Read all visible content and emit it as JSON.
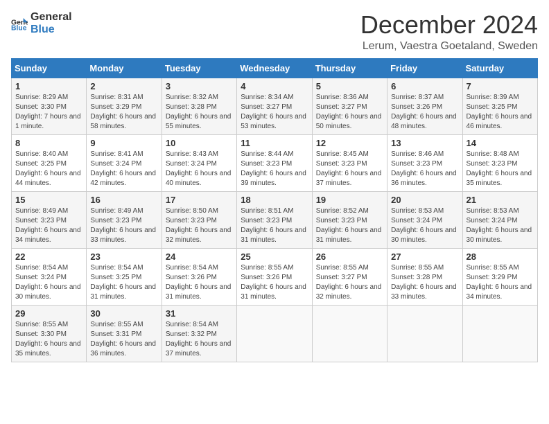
{
  "header": {
    "logo_general": "General",
    "logo_blue": "Blue",
    "title": "December 2024",
    "subtitle": "Lerum, Vaestra Goetaland, Sweden"
  },
  "weekdays": [
    "Sunday",
    "Monday",
    "Tuesday",
    "Wednesday",
    "Thursday",
    "Friday",
    "Saturday"
  ],
  "weeks": [
    [
      {
        "day": "1",
        "sunrise": "Sunrise: 8:29 AM",
        "sunset": "Sunset: 3:30 PM",
        "daylight": "Daylight: 7 hours and 1 minute."
      },
      {
        "day": "2",
        "sunrise": "Sunrise: 8:31 AM",
        "sunset": "Sunset: 3:29 PM",
        "daylight": "Daylight: 6 hours and 58 minutes."
      },
      {
        "day": "3",
        "sunrise": "Sunrise: 8:32 AM",
        "sunset": "Sunset: 3:28 PM",
        "daylight": "Daylight: 6 hours and 55 minutes."
      },
      {
        "day": "4",
        "sunrise": "Sunrise: 8:34 AM",
        "sunset": "Sunset: 3:27 PM",
        "daylight": "Daylight: 6 hours and 53 minutes."
      },
      {
        "day": "5",
        "sunrise": "Sunrise: 8:36 AM",
        "sunset": "Sunset: 3:27 PM",
        "daylight": "Daylight: 6 hours and 50 minutes."
      },
      {
        "day": "6",
        "sunrise": "Sunrise: 8:37 AM",
        "sunset": "Sunset: 3:26 PM",
        "daylight": "Daylight: 6 hours and 48 minutes."
      },
      {
        "day": "7",
        "sunrise": "Sunrise: 8:39 AM",
        "sunset": "Sunset: 3:25 PM",
        "daylight": "Daylight: 6 hours and 46 minutes."
      }
    ],
    [
      {
        "day": "8",
        "sunrise": "Sunrise: 8:40 AM",
        "sunset": "Sunset: 3:25 PM",
        "daylight": "Daylight: 6 hours and 44 minutes."
      },
      {
        "day": "9",
        "sunrise": "Sunrise: 8:41 AM",
        "sunset": "Sunset: 3:24 PM",
        "daylight": "Daylight: 6 hours and 42 minutes."
      },
      {
        "day": "10",
        "sunrise": "Sunrise: 8:43 AM",
        "sunset": "Sunset: 3:24 PM",
        "daylight": "Daylight: 6 hours and 40 minutes."
      },
      {
        "day": "11",
        "sunrise": "Sunrise: 8:44 AM",
        "sunset": "Sunset: 3:23 PM",
        "daylight": "Daylight: 6 hours and 39 minutes."
      },
      {
        "day": "12",
        "sunrise": "Sunrise: 8:45 AM",
        "sunset": "Sunset: 3:23 PM",
        "daylight": "Daylight: 6 hours and 37 minutes."
      },
      {
        "day": "13",
        "sunrise": "Sunrise: 8:46 AM",
        "sunset": "Sunset: 3:23 PM",
        "daylight": "Daylight: 6 hours and 36 minutes."
      },
      {
        "day": "14",
        "sunrise": "Sunrise: 8:48 AM",
        "sunset": "Sunset: 3:23 PM",
        "daylight": "Daylight: 6 hours and 35 minutes."
      }
    ],
    [
      {
        "day": "15",
        "sunrise": "Sunrise: 8:49 AM",
        "sunset": "Sunset: 3:23 PM",
        "daylight": "Daylight: 6 hours and 34 minutes."
      },
      {
        "day": "16",
        "sunrise": "Sunrise: 8:49 AM",
        "sunset": "Sunset: 3:23 PM",
        "daylight": "Daylight: 6 hours and 33 minutes."
      },
      {
        "day": "17",
        "sunrise": "Sunrise: 8:50 AM",
        "sunset": "Sunset: 3:23 PM",
        "daylight": "Daylight: 6 hours and 32 minutes."
      },
      {
        "day": "18",
        "sunrise": "Sunrise: 8:51 AM",
        "sunset": "Sunset: 3:23 PM",
        "daylight": "Daylight: 6 hours and 31 minutes."
      },
      {
        "day": "19",
        "sunrise": "Sunrise: 8:52 AM",
        "sunset": "Sunset: 3:23 PM",
        "daylight": "Daylight: 6 hours and 31 minutes."
      },
      {
        "day": "20",
        "sunrise": "Sunrise: 8:53 AM",
        "sunset": "Sunset: 3:24 PM",
        "daylight": "Daylight: 6 hours and 30 minutes."
      },
      {
        "day": "21",
        "sunrise": "Sunrise: 8:53 AM",
        "sunset": "Sunset: 3:24 PM",
        "daylight": "Daylight: 6 hours and 30 minutes."
      }
    ],
    [
      {
        "day": "22",
        "sunrise": "Sunrise: 8:54 AM",
        "sunset": "Sunset: 3:24 PM",
        "daylight": "Daylight: 6 hours and 30 minutes."
      },
      {
        "day": "23",
        "sunrise": "Sunrise: 8:54 AM",
        "sunset": "Sunset: 3:25 PM",
        "daylight": "Daylight: 6 hours and 31 minutes."
      },
      {
        "day": "24",
        "sunrise": "Sunrise: 8:54 AM",
        "sunset": "Sunset: 3:26 PM",
        "daylight": "Daylight: 6 hours and 31 minutes."
      },
      {
        "day": "25",
        "sunrise": "Sunrise: 8:55 AM",
        "sunset": "Sunset: 3:26 PM",
        "daylight": "Daylight: 6 hours and 31 minutes."
      },
      {
        "day": "26",
        "sunrise": "Sunrise: 8:55 AM",
        "sunset": "Sunset: 3:27 PM",
        "daylight": "Daylight: 6 hours and 32 minutes."
      },
      {
        "day": "27",
        "sunrise": "Sunrise: 8:55 AM",
        "sunset": "Sunset: 3:28 PM",
        "daylight": "Daylight: 6 hours and 33 minutes."
      },
      {
        "day": "28",
        "sunrise": "Sunrise: 8:55 AM",
        "sunset": "Sunset: 3:29 PM",
        "daylight": "Daylight: 6 hours and 34 minutes."
      }
    ],
    [
      {
        "day": "29",
        "sunrise": "Sunrise: 8:55 AM",
        "sunset": "Sunset: 3:30 PM",
        "daylight": "Daylight: 6 hours and 35 minutes."
      },
      {
        "day": "30",
        "sunrise": "Sunrise: 8:55 AM",
        "sunset": "Sunset: 3:31 PM",
        "daylight": "Daylight: 6 hours and 36 minutes."
      },
      {
        "day": "31",
        "sunrise": "Sunrise: 8:54 AM",
        "sunset": "Sunset: 3:32 PM",
        "daylight": "Daylight: 6 hours and 37 minutes."
      },
      null,
      null,
      null,
      null
    ]
  ]
}
